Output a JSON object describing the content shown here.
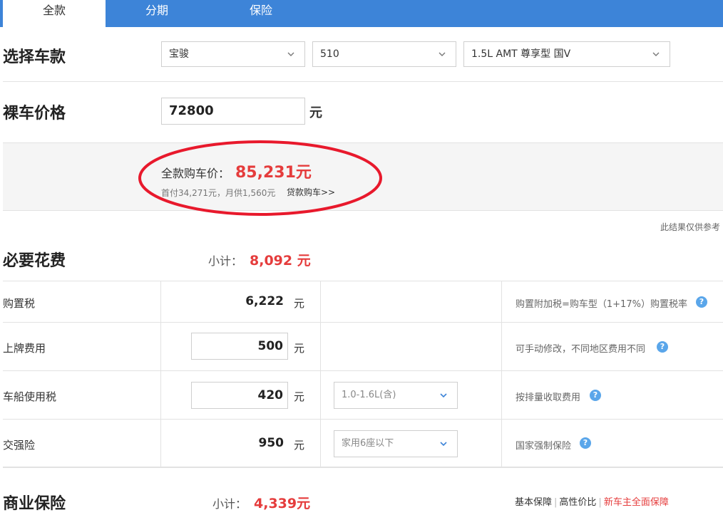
{
  "tabs": [
    {
      "label": "全款"
    },
    {
      "label": "分期"
    },
    {
      "label": "保险"
    }
  ],
  "select_car": {
    "title": "选择车款",
    "brand": "宝骏",
    "model": "510",
    "trim": "1.5L AMT 尊享型 国V"
  },
  "bare_price": {
    "title": "裸车价格",
    "value": "72800",
    "unit": "元"
  },
  "result": {
    "label": "全款购车价：",
    "total": "85,231元",
    "sub": "首付34,271元，月供1,560元",
    "loan_link": "贷款购车>>"
  },
  "disclaimer": "此结果仅供参考",
  "necessary": {
    "title": "必要花费",
    "subtotal_label": "小计：",
    "subtotal_value": "8,092 元",
    "rows": [
      {
        "label": "购置税",
        "value": "6,222",
        "unit": "元",
        "desc": "购置附加税=购车型（1+17%）购置税率"
      },
      {
        "label": "上牌费用",
        "value": "500",
        "unit": "元",
        "desc": "可手动修改，不同地区费用不同"
      },
      {
        "label": "车船使用税",
        "value": "420",
        "unit": "元",
        "option": "1.0-1.6L(含)",
        "desc": "按排量收取费用"
      },
      {
        "label": "交强险",
        "value": "950",
        "unit": "元",
        "option": "家用6座以下",
        "desc": "国家强制保险"
      }
    ]
  },
  "commercial": {
    "title": "商业保险",
    "subtotal_label": "小计：",
    "subtotal_value": "4,339元",
    "links": [
      "基本保障",
      "高性价比",
      "新车主全面保障"
    ]
  },
  "colors": {
    "tab_bar": "#3d84d8",
    "accent_red": "#e53c3c",
    "help_icon": "#5aa6ea"
  }
}
